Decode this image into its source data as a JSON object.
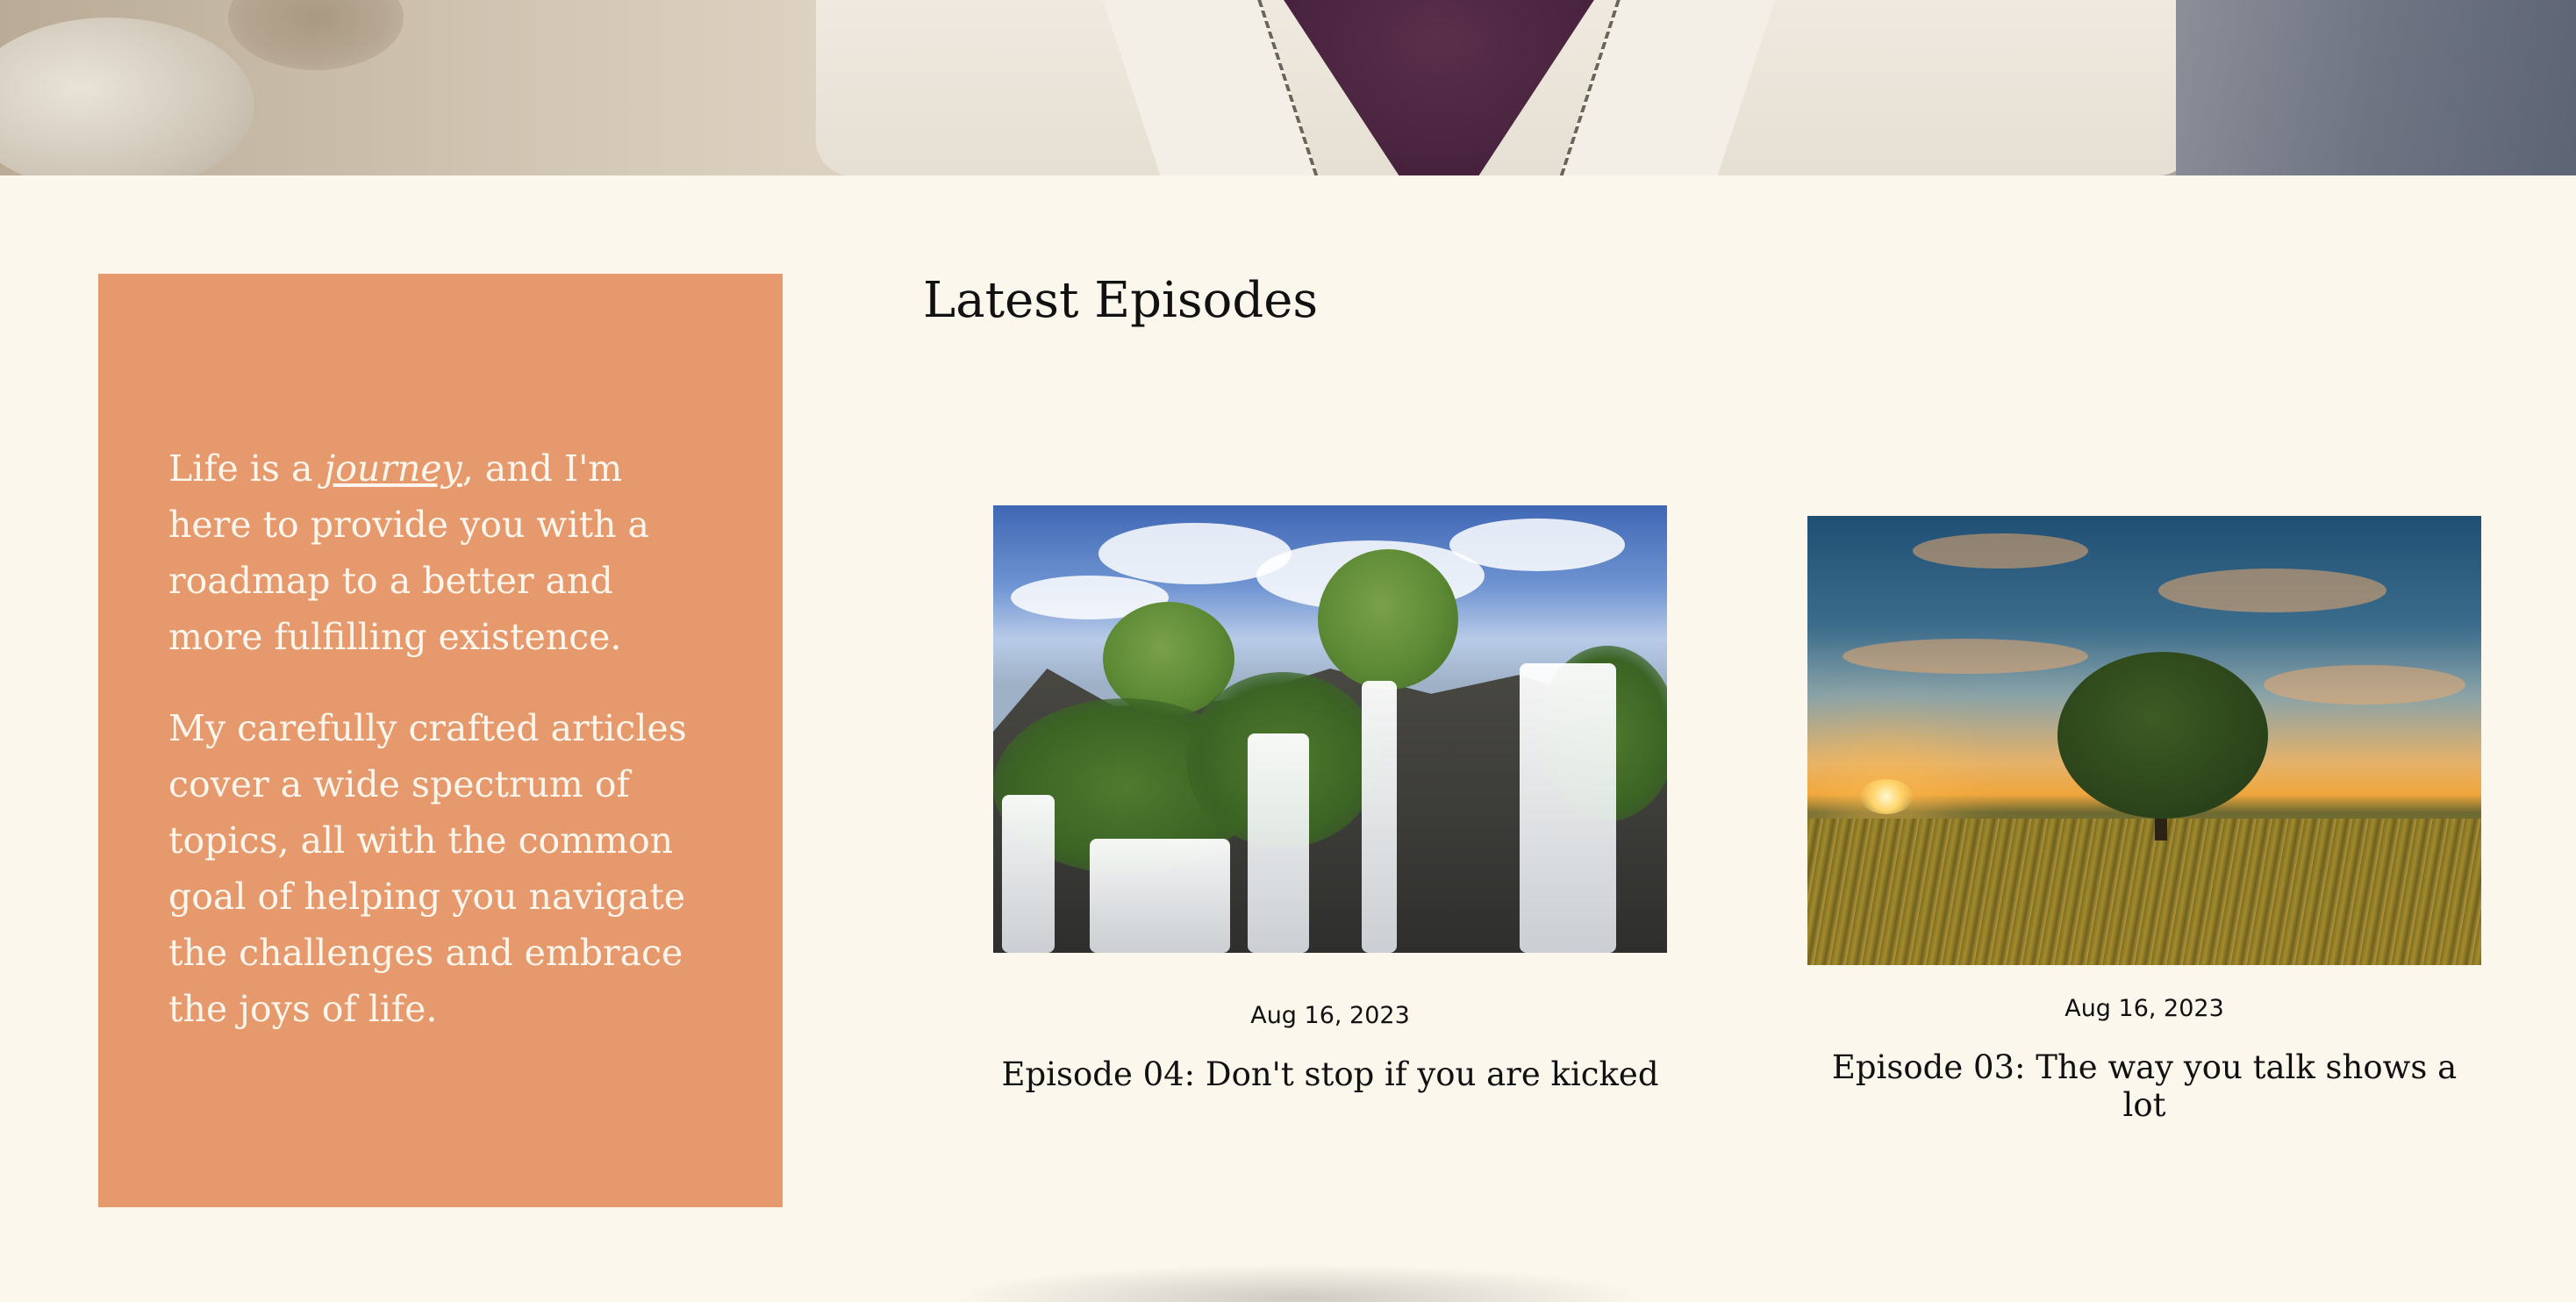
{
  "intro": {
    "p1_before": "Life is a ",
    "p1_emphasis": "journey",
    "p1_after": ", and I'm here to provide you with a roadmap to a better and more fulfilling existence.",
    "p2": "My carefully crafted articles cover a wide spectrum of topics, all with the common goal of helping you navigate the challenges and embrace the joys of life."
  },
  "episodes_section": {
    "title": "Latest Episodes",
    "items": [
      {
        "date": "Aug 16, 2023",
        "title": "Episode 04: Don't stop if you are kicked",
        "image": "waterfall-photo"
      },
      {
        "date": "Aug 16, 2023",
        "title": "Episode 03: The way you talk shows a lot",
        "image": "sunset-tree-photo"
      }
    ]
  },
  "colors": {
    "page_bg": "#fcf7ed",
    "intro_card_bg": "#e6996c",
    "intro_text": "#fdf6ec",
    "heading_text": "#111111"
  }
}
